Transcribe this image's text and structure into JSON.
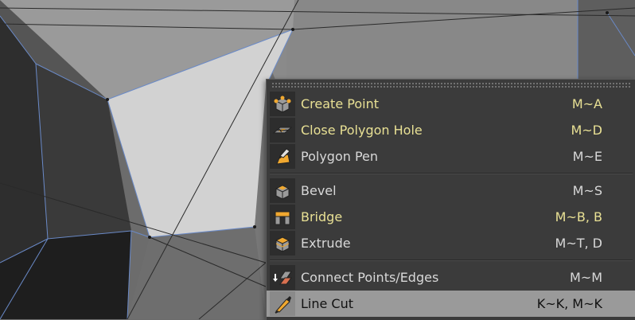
{
  "menu": {
    "groups": [
      {
        "items": [
          {
            "label": "Create Point",
            "shortcut": "M~A",
            "icon": "create-point-icon",
            "highlighted": true
          },
          {
            "label": "Close Polygon Hole",
            "shortcut": "M~D",
            "icon": "close-polygon-hole-icon",
            "highlighted": true
          },
          {
            "label": "Polygon Pen",
            "shortcut": "M~E",
            "icon": "polygon-pen-icon",
            "highlighted": false
          }
        ]
      },
      {
        "items": [
          {
            "label": "Bevel",
            "shortcut": "M~S",
            "icon": "bevel-icon",
            "highlighted": false
          },
          {
            "label": "Bridge",
            "shortcut": "M~B, B",
            "icon": "bridge-icon",
            "highlighted": true
          },
          {
            "label": "Extrude",
            "shortcut": "M~T, D",
            "icon": "extrude-icon",
            "highlighted": false
          }
        ]
      },
      {
        "items": [
          {
            "label": "Connect Points/Edges",
            "shortcut": "M~M",
            "icon": "connect-points-edges-icon",
            "highlighted": false
          },
          {
            "label": "Line Cut",
            "shortcut": "K~K, M~K",
            "icon": "line-cut-icon",
            "highlighted": false,
            "selected": true
          }
        ]
      }
    ]
  },
  "colors": {
    "menu_bg": "#3b3b3b",
    "highlight_text": "#e8e094",
    "selected_bg": "#9a9a9a",
    "icon_orange": "#f0a830",
    "mesh_edge": "#6a8ac8"
  }
}
